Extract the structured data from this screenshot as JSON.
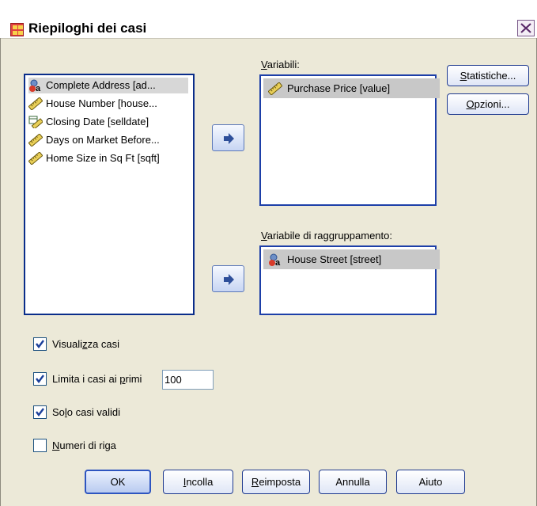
{
  "window": {
    "title": "Riepiloghi dei casi"
  },
  "source_list": [
    {
      "label": "Complete Address [ad...",
      "icon": "nominal-string-icon",
      "selected": true
    },
    {
      "label": "House Number [house...",
      "icon": "scale-ruler-icon",
      "selected": false
    },
    {
      "label": "Closing Date [selldate]",
      "icon": "date-scale-icon",
      "selected": false
    },
    {
      "label": "Days on Market Before...",
      "icon": "scale-ruler-icon",
      "selected": false
    },
    {
      "label": "Home Size in Sq Ft [sqft]",
      "icon": "scale-ruler-icon",
      "selected": false
    }
  ],
  "variables": {
    "label_u": "V",
    "label_rest": "ariabili:",
    "items": [
      {
        "label": "Purchase Price [value]",
        "icon": "scale-ruler-icon"
      }
    ]
  },
  "grouping": {
    "label_u": "V",
    "label_rest": "ariabile di raggruppamento:",
    "items": [
      {
        "label": "House Street [street]",
        "icon": "nominal-string-icon"
      }
    ]
  },
  "side_buttons": {
    "statistics": {
      "u": "S",
      "rest": "tatistiche..."
    },
    "options": {
      "u": "O",
      "rest": "pzioni..."
    }
  },
  "options": {
    "display_cases": {
      "pre": "Visuali",
      "u": "z",
      "post": "za casi",
      "checked": true
    },
    "limit_cases": {
      "pre": "Limita i casi ai ",
      "u": "p",
      "post": "rimi",
      "checked": true,
      "value": "100"
    },
    "valid_only": {
      "pre": "So",
      "u": "l",
      "post": "o casi validi",
      "checked": true
    },
    "row_numbers": {
      "pre": "",
      "u": "N",
      "post": "umeri di riga",
      "checked": false
    }
  },
  "buttons": {
    "ok": "OK",
    "paste": {
      "u": "I",
      "rest": "ncolla"
    },
    "reset": {
      "u": "R",
      "rest": "eimposta"
    },
    "cancel": "Annulla",
    "help": "Aiuto"
  },
  "colors": {
    "dialog_bg": "#ece9d8",
    "list_border": "#1d3fa8",
    "selection": "#c8c8c8"
  }
}
